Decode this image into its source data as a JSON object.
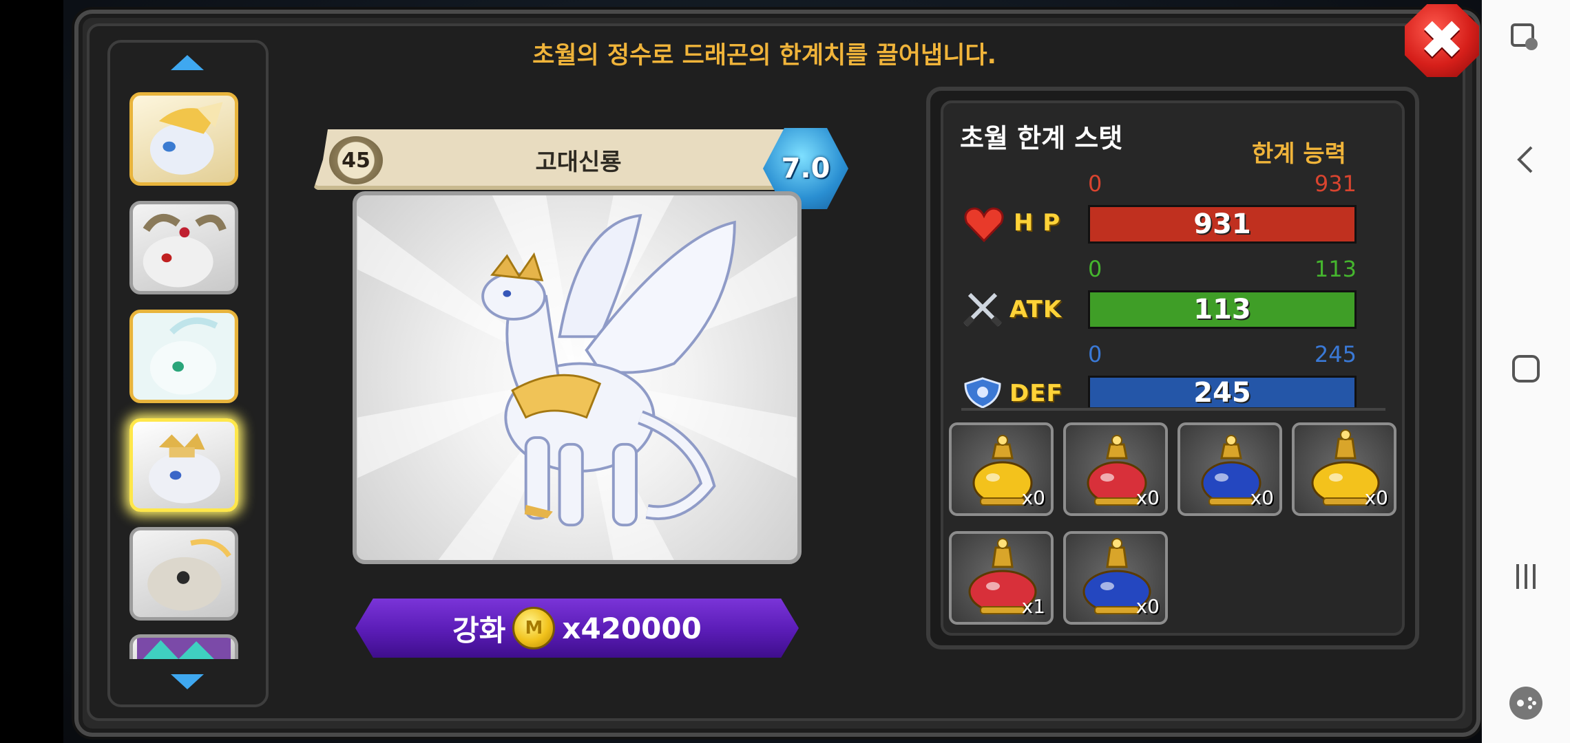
{
  "header": {
    "message": "초월의 정수로 드래곤의 한계치를 끌어냅니다."
  },
  "close_label": "✖",
  "dragon_list": {
    "items": [
      {
        "name": "dragon-1",
        "frame": "gold"
      },
      {
        "name": "dragon-2",
        "frame": "silver"
      },
      {
        "name": "dragon-3",
        "frame": "gold"
      },
      {
        "name": "dragon-4",
        "frame": "selected"
      },
      {
        "name": "dragon-5",
        "frame": "silver"
      },
      {
        "name": "dragon-6",
        "frame": "silver"
      }
    ]
  },
  "dragon": {
    "level": "45",
    "name": "고대신룡",
    "grade": "7.0"
  },
  "enhance": {
    "label": "강화",
    "coin_symbol": "M",
    "cost": "x420000"
  },
  "stats": {
    "title": "초월 한계 스탯",
    "subtitle": "한계 능력",
    "hp": {
      "label": "H P",
      "min": "0",
      "max": "931",
      "value": "931",
      "fill": 1.0,
      "color": "#c0301f",
      "range_color": "#d9442f"
    },
    "atk": {
      "label": "ATK",
      "min": "0",
      "max": "113",
      "value": "113",
      "fill": 1.0,
      "color": "#3f9e27",
      "range_color": "#45b52e"
    },
    "def": {
      "label": "DEF",
      "min": "0",
      "max": "245",
      "value": "245",
      "fill": 1.0,
      "color": "#2456a8",
      "range_color": "#3a79d6"
    }
  },
  "items": [
    {
      "name": "gold-potion",
      "count": "x0",
      "color": "#f3c21c"
    },
    {
      "name": "red-potion",
      "count": "x0",
      "color": "#d8303a"
    },
    {
      "name": "blue-potion",
      "count": "x0",
      "color": "#2447c0"
    },
    {
      "name": "gold-large-potion",
      "count": "x0",
      "color": "#f3c21c"
    },
    {
      "name": "red-large-potion",
      "count": "x1",
      "color": "#d8303a"
    },
    {
      "name": "blue-large-potion",
      "count": "x0",
      "color": "#2447c0"
    }
  ]
}
